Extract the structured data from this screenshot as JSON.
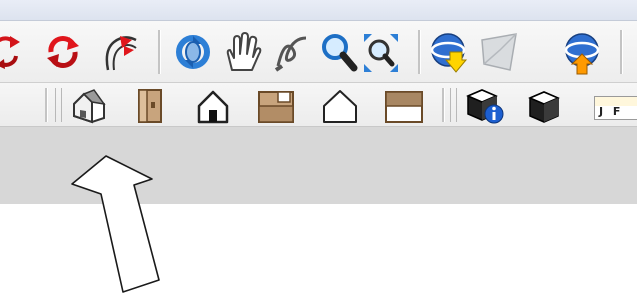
{
  "window": {
    "title_bar_color": "#e2e7f1"
  },
  "toolbar_top": {
    "buttons": [
      {
        "name": "orbit-partial-icon",
        "color": "#d3141a"
      },
      {
        "name": "orbit-icon",
        "color": "#d3141a"
      },
      {
        "name": "previous-view-icon",
        "color": "#d3141a"
      },
      {
        "name": "walk-orbit-icon",
        "color": "#2d7fd6"
      },
      {
        "name": "pan-hand-icon",
        "color": "#555555"
      },
      {
        "name": "zoom-window-icon",
        "color": "#555555"
      },
      {
        "name": "zoom-icon",
        "color": "#2d7fd6"
      },
      {
        "name": "zoom-extents-icon",
        "color": "#2d7fd6"
      },
      {
        "name": "get-models-icon",
        "color": "#1f5bb8"
      },
      {
        "name": "toggle-terrain-icon",
        "color": "#9aa0a6"
      },
      {
        "name": "share-model-icon",
        "color": "#1f5bb8"
      }
    ]
  },
  "toolbar_views": {
    "buttons": [
      {
        "name": "iso-view-icon"
      },
      {
        "name": "right-view-icon"
      },
      {
        "name": "front-view-icon"
      },
      {
        "name": "top-view-icon"
      },
      {
        "name": "back-view-icon"
      },
      {
        "name": "bottom-view-icon"
      },
      {
        "name": "model-info-icon"
      },
      {
        "name": "shaded-style-icon"
      }
    ],
    "month_slider_label": "J F"
  },
  "annotation": {
    "type": "hand-drawn arrow",
    "points_to": "iso-view-icon"
  }
}
